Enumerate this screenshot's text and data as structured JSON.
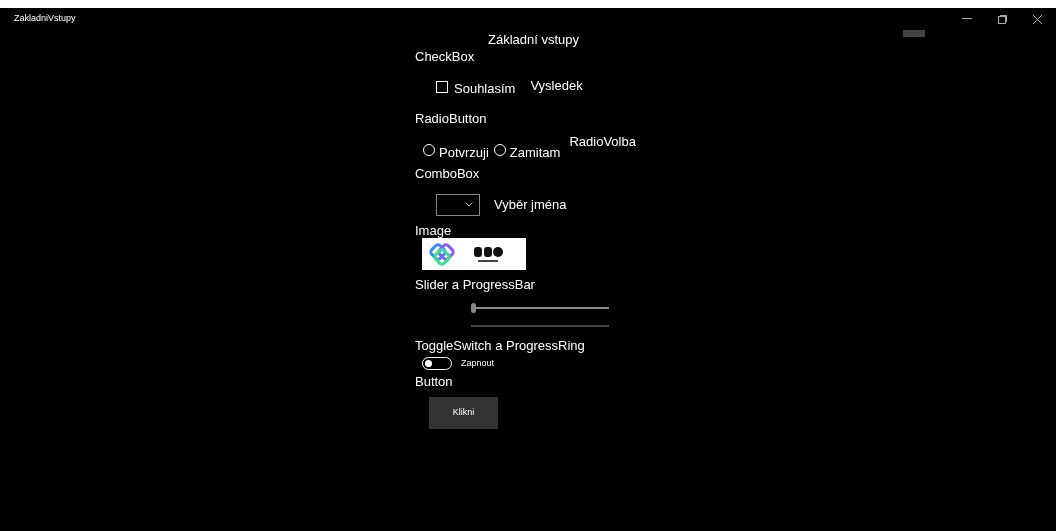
{
  "window": {
    "title": "ZakladniVstupy"
  },
  "heading": "Základní vstupy",
  "checkbox_section": {
    "label": "CheckBox",
    "checkbox": {
      "label": "Souhlasím",
      "checked": false
    },
    "result": "Vysledek"
  },
  "radio_section": {
    "label": "RadioButton",
    "options": [
      {
        "label": "Potvrzuji",
        "selected": false
      },
      {
        "label": "Zamitam",
        "selected": false
      }
    ],
    "result": "RadioVolba"
  },
  "combo_section": {
    "label": "ComboBox",
    "result": "Vyběr jména"
  },
  "image_section": {
    "label": "Image"
  },
  "slider_section": {
    "label": "Slider a ProgressBar",
    "slider": {
      "level": 0
    },
    "progress": {
      "level": 0
    }
  },
  "toggle_section": {
    "label": "ToggleSwitch a ProgressRing",
    "toggle": {
      "label": "Zapnout",
      "on": false
    }
  },
  "button_section": {
    "label": "Button",
    "button": "Klikni"
  }
}
